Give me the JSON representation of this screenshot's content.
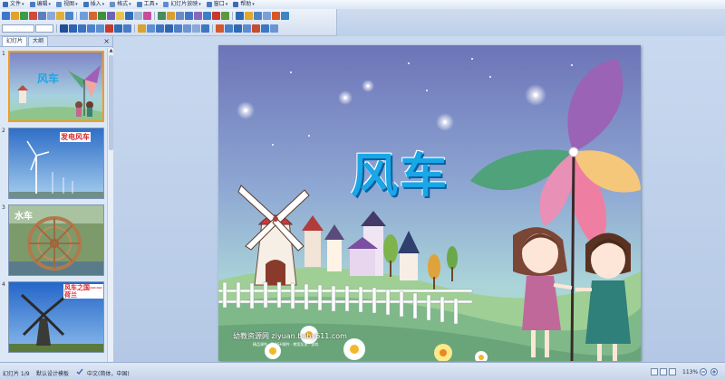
{
  "menubar": {
    "items": [
      {
        "label": "文件",
        "color": "#3b6cb7"
      },
      {
        "label": "编辑",
        "color": "#4a7bc5"
      },
      {
        "label": "视图",
        "color": "#5b8bd0"
      },
      {
        "label": "插入",
        "color": "#3f74c0"
      },
      {
        "label": "格式",
        "color": "#6b8fc7"
      },
      {
        "label": "工具",
        "color": "#4d7fc4"
      },
      {
        "label": "幻灯片放映",
        "color": "#5e8cd2"
      },
      {
        "label": "窗口",
        "color": "#4b79bf"
      },
      {
        "label": "帮助",
        "color": "#3c6ab5"
      }
    ]
  },
  "toolbar": {
    "font_value": "",
    "size_value": "",
    "row1_colors": [
      "#3b78c7",
      "#e1a32a",
      "#3c9b4a",
      "#d24a3c",
      "#5a7fbf",
      "#8aa9d8",
      "#e0b03a",
      "#4e86cc",
      "#6b9edb",
      "#d6652f",
      "#3f8f3f",
      "#6c63b8",
      "#e6c54a",
      "#2f6fb8",
      "#a3b8d9",
      "#c74e9c",
      "#4b8b5a",
      "#d9a02f",
      "#6a8cc4",
      "#4276c2",
      "#8a67b9",
      "#3e7fc8",
      "#c9382e",
      "#5b9a3c",
      "#2e6ab0",
      "#e0a82c",
      "#4f83c9",
      "#7aa0d6",
      "#d7572b",
      "#3c86c2"
    ],
    "row2_colors": [
      "#1f4e96",
      "#2e63b3",
      "#3b73c2",
      "#4c82cc",
      "#5a8fd3",
      "#c8392b",
      "#2e6cb5",
      "#4b7dc6",
      "#d9a32f",
      "#5e91d4",
      "#3d74bf",
      "#2f65b0",
      "#4c80c9",
      "#6d95d1",
      "#8aa9d8",
      "#3f76c0",
      "#d5582e",
      "#4a7ec6",
      "#2f6ab4",
      "#5b8cd0",
      "#c74b2e",
      "#3b78c4",
      "#6a94d2"
    ]
  },
  "left_pane": {
    "tabs": [
      "幻灯片",
      "大纲"
    ],
    "close_glyph": "×",
    "slides": [
      {
        "number": "1",
        "label": "风车",
        "label_color": "#1aa7e8",
        "bg_top": "#8fa3d6",
        "bg_bottom": "#9fd6a2",
        "selected": true
      },
      {
        "number": "2",
        "label": "发电风车",
        "label_color": "#d8262c",
        "bg_top": "#3f7fcf",
        "bg_bottom": "#9cc6ea",
        "selected": false
      },
      {
        "number": "3",
        "label": "水车",
        "label_color": "#ffffff",
        "bg_top": "#6f8f5a",
        "bg_bottom": "#8d6b43",
        "selected": false
      },
      {
        "number": "4",
        "label": "风车之国——荷兰",
        "label_color": "#d8262c",
        "bg_top": "#2a68c9",
        "bg_bottom": "#7fb1e8",
        "selected": false
      }
    ]
  },
  "slide": {
    "title": "风车",
    "watermark": "幼教资源网 ziyuan.baby611.com",
    "watermark_sub": "精品课件 · FLASH课件 · 教案反思 · 游戏",
    "colors": {
      "sky_top": "#6e78b8",
      "sky_mid": "#93b7d6",
      "hill": "#8fc58d",
      "hill_dark": "#5e9e72",
      "title": "#1aa7e8"
    }
  },
  "status": {
    "slide_info": "幻灯片 1/9",
    "design": "默认设计模板",
    "language": "中文(简体，中国)",
    "zoom": "113%"
  }
}
